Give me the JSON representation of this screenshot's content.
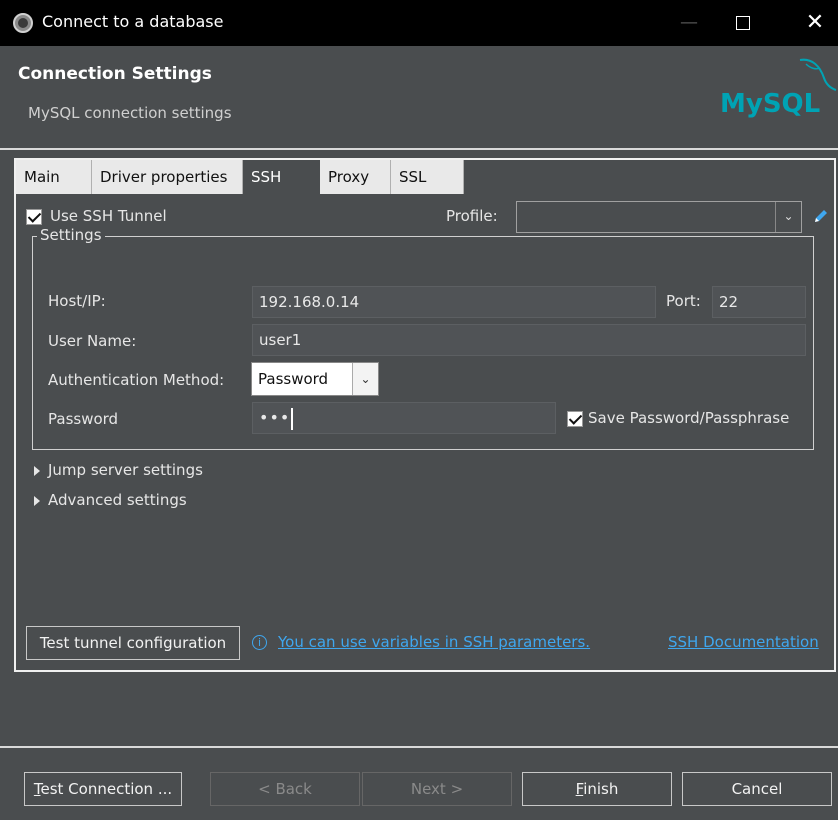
{
  "window": {
    "title": "Connect to a database",
    "minimize_glyph": "—",
    "close_glyph": "✕"
  },
  "header": {
    "title": "Connection Settings",
    "subtitle": "MySQL connection settings",
    "logo_text": "MySQL",
    "logo_color": "#00a3b4"
  },
  "tabs": [
    {
      "label": "Main"
    },
    {
      "label": "Driver properties"
    },
    {
      "label": "SSH",
      "active": true
    },
    {
      "label": "Proxy"
    },
    {
      "label": "SSL"
    }
  ],
  "ssh": {
    "use_tunnel_label": "Use SSH Tunnel",
    "use_tunnel_checked": true,
    "profile_label": "Profile:",
    "profile_value": "",
    "settings_legend": "Settings",
    "host_label": "Host/IP:",
    "host_value": "192.168.0.14",
    "port_label": "Port:",
    "port_value": "22",
    "user_label": "User Name:",
    "user_value": "user1",
    "auth_label": "Authentication Method:",
    "auth_value": "Password",
    "password_label": "Password",
    "password_value": "•••",
    "save_password_label": "Save Password/Passphrase",
    "save_password_checked": true,
    "jump_server_label": "Jump server settings",
    "advanced_label": "Advanced settings",
    "test_tunnel_label": "Test tunnel configuration",
    "info_glyph": "i",
    "variables_link": "You can use variables in SSH parameters.",
    "doc_link": "SSH Documentation"
  },
  "footer": {
    "test_connection_rest": "est Connection ...",
    "test_connection_mnemonic": "T",
    "back_label": "< Back",
    "next_label": "Next >",
    "finish_mnemonic": "F",
    "finish_rest": "inish",
    "cancel_label": "Cancel"
  },
  "colors": {
    "background": "#4a4d4f",
    "link": "#3fa7ef",
    "accent_pencil": "#3fa7ef"
  }
}
